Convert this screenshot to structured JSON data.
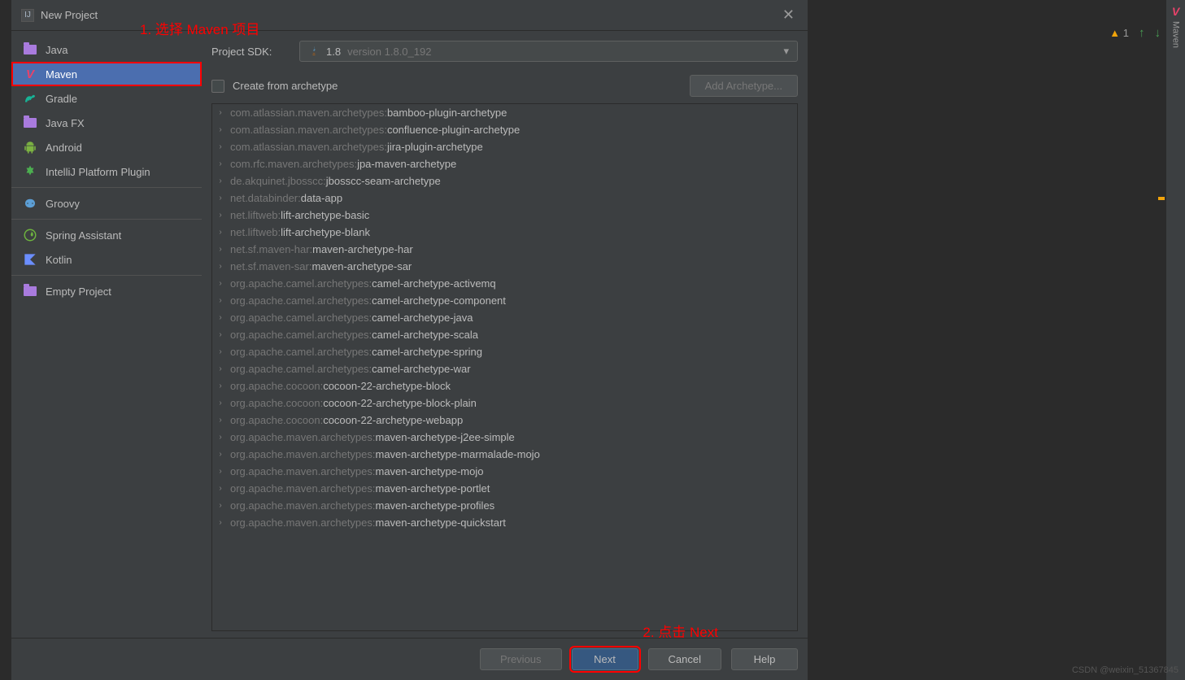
{
  "titlebar": {
    "title": "New Project"
  },
  "annotations": {
    "step1": "1. 选择 Maven 项目",
    "step2": "2. 点击 Next"
  },
  "sidebar": {
    "items": [
      {
        "label": "Java",
        "iconType": "folder",
        "iconColor": "#a97bde"
      },
      {
        "label": "Maven",
        "iconType": "maven",
        "iconColor": "#e8426a",
        "selected": true
      },
      {
        "label": "Gradle",
        "iconType": "gradle",
        "iconColor": "#17b396"
      },
      {
        "label": "Java FX",
        "iconType": "folder",
        "iconColor": "#a97bde"
      },
      {
        "label": "Android",
        "iconType": "android",
        "iconColor": "#7cb342"
      },
      {
        "label": "IntelliJ Platform Plugin",
        "iconType": "plugin",
        "iconColor": "#4caf50"
      },
      {
        "label": "Groovy",
        "iconType": "groovy",
        "iconColor": "#5c9fd6"
      },
      {
        "label": "Spring Assistant",
        "iconType": "spring",
        "iconColor": "#6db33f"
      },
      {
        "label": "Kotlin",
        "iconType": "kotlin",
        "iconColor": "#6b8eff"
      },
      {
        "label": "Empty Project",
        "iconType": "folder",
        "iconColor": "#a97bde"
      }
    ]
  },
  "sdk": {
    "label": "Project SDK:",
    "value": "1.8",
    "version": "version 1.8.0_192"
  },
  "archetype": {
    "checkboxLabel": "Create from archetype",
    "addButtonLabel": "Add Archetype...",
    "items": [
      {
        "group": "com.atlassian.maven.archetypes:",
        "name": "bamboo-plugin-archetype"
      },
      {
        "group": "com.atlassian.maven.archetypes:",
        "name": "confluence-plugin-archetype"
      },
      {
        "group": "com.atlassian.maven.archetypes:",
        "name": "jira-plugin-archetype"
      },
      {
        "group": "com.rfc.maven.archetypes:",
        "name": "jpa-maven-archetype"
      },
      {
        "group": "de.akquinet.jbosscc:",
        "name": "jbosscc-seam-archetype"
      },
      {
        "group": "net.databinder:",
        "name": "data-app"
      },
      {
        "group": "net.liftweb:",
        "name": "lift-archetype-basic"
      },
      {
        "group": "net.liftweb:",
        "name": "lift-archetype-blank"
      },
      {
        "group": "net.sf.maven-har:",
        "name": "maven-archetype-har"
      },
      {
        "group": "net.sf.maven-sar:",
        "name": "maven-archetype-sar"
      },
      {
        "group": "org.apache.camel.archetypes:",
        "name": "camel-archetype-activemq"
      },
      {
        "group": "org.apache.camel.archetypes:",
        "name": "camel-archetype-component"
      },
      {
        "group": "org.apache.camel.archetypes:",
        "name": "camel-archetype-java"
      },
      {
        "group": "org.apache.camel.archetypes:",
        "name": "camel-archetype-scala"
      },
      {
        "group": "org.apache.camel.archetypes:",
        "name": "camel-archetype-spring"
      },
      {
        "group": "org.apache.camel.archetypes:",
        "name": "camel-archetype-war"
      },
      {
        "group": "org.apache.cocoon:",
        "name": "cocoon-22-archetype-block"
      },
      {
        "group": "org.apache.cocoon:",
        "name": "cocoon-22-archetype-block-plain"
      },
      {
        "group": "org.apache.cocoon:",
        "name": "cocoon-22-archetype-webapp"
      },
      {
        "group": "org.apache.maven.archetypes:",
        "name": "maven-archetype-j2ee-simple"
      },
      {
        "group": "org.apache.maven.archetypes:",
        "name": "maven-archetype-marmalade-mojo"
      },
      {
        "group": "org.apache.maven.archetypes:",
        "name": "maven-archetype-mojo"
      },
      {
        "group": "org.apache.maven.archetypes:",
        "name": "maven-archetype-portlet"
      },
      {
        "group": "org.apache.maven.archetypes:",
        "name": "maven-archetype-profiles"
      },
      {
        "group": "org.apache.maven.archetypes:",
        "name": "maven-archetype-quickstart"
      }
    ]
  },
  "footer": {
    "previous": "Previous",
    "next": "Next",
    "cancel": "Cancel",
    "help": "Help"
  },
  "rightGutter": {
    "label": "Maven"
  },
  "status": {
    "warnCount": "1"
  },
  "watermark": "CSDN @weixin_51367845"
}
